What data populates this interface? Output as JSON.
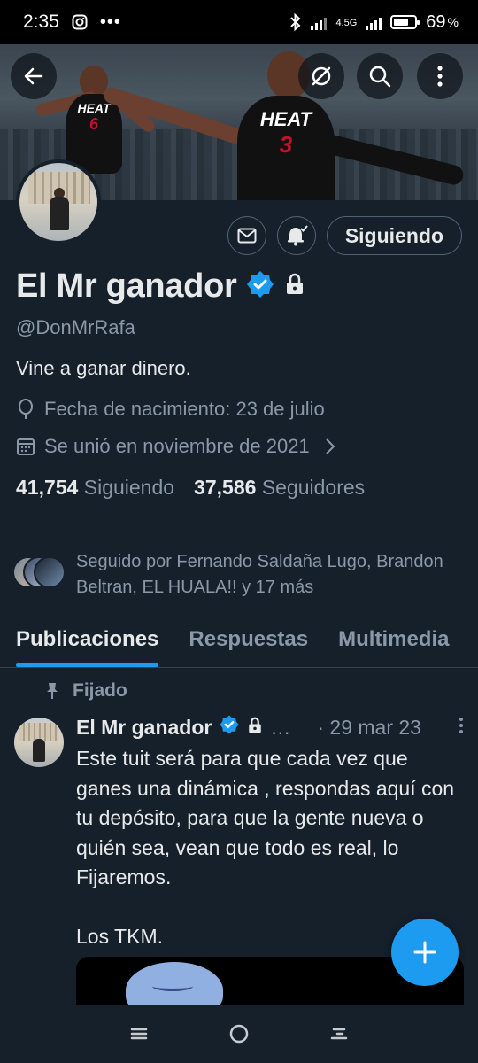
{
  "status_bar": {
    "time": "2:35",
    "network": "4.5G",
    "battery": "69"
  },
  "profile": {
    "display_name": "El Mr ganador",
    "handle": "@DonMrRafa",
    "bio": "Vine a ganar dinero.",
    "birthday": "Fecha de nacimiento: 23 de julio",
    "joined": "Se unió en noviembre de 2021",
    "following_count": "41,754",
    "following_label": "Siguiendo",
    "followers_count": "37,586",
    "followers_label": "Seguidores",
    "follow_button_label": "Siguiendo",
    "followed_by": "Seguido por Fernando Saldaña Lugo, Brandon Beltran, EL HUALA!! y 17 más"
  },
  "banner": {
    "jersey_left_text": "HEAT",
    "jersey_left_number": "6",
    "jersey_right_text": "HEAT",
    "jersey_right_number": "3"
  },
  "tabs": [
    {
      "label": "Publicaciones",
      "active": true
    },
    {
      "label": "Respuestas",
      "active": false
    },
    {
      "label": "Multimedia",
      "active": false
    }
  ],
  "pinned_label": "Fijado",
  "tweet": {
    "author": "El Mr ganador",
    "ellipsis": "…",
    "date": "· 29 mar 23",
    "text": "Este tuit será para que cada vez que ganes una dinámica , respondas aquí con tu depósito, para que la gente nueva o quién sea, vean que todo es real, lo Fijaremos.\n\nLos TKM."
  },
  "colors": {
    "accent": "#1d9bf0",
    "background": "#15202b",
    "secondary_text": "#8b98a5"
  }
}
